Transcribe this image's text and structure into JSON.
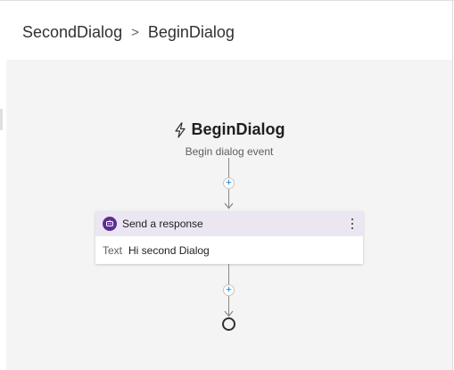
{
  "breadcrumb": {
    "items": [
      "SecondDialog",
      "BeginDialog"
    ],
    "separator": ">"
  },
  "trigger": {
    "title": "BeginDialog",
    "subtitle": "Begin dialog event",
    "icon": "lightning-icon"
  },
  "action_card": {
    "title": "Send a response",
    "icon": "bot-icon",
    "field_label": "Text",
    "field_value": "Hi second Dialog"
  },
  "add_buttons": [
    "+",
    "+"
  ],
  "colors": {
    "canvas": "#f4f4f4",
    "card_header": "#ebe6f2",
    "bot_icon": "#5c2d91",
    "plus": "#0078d4"
  }
}
